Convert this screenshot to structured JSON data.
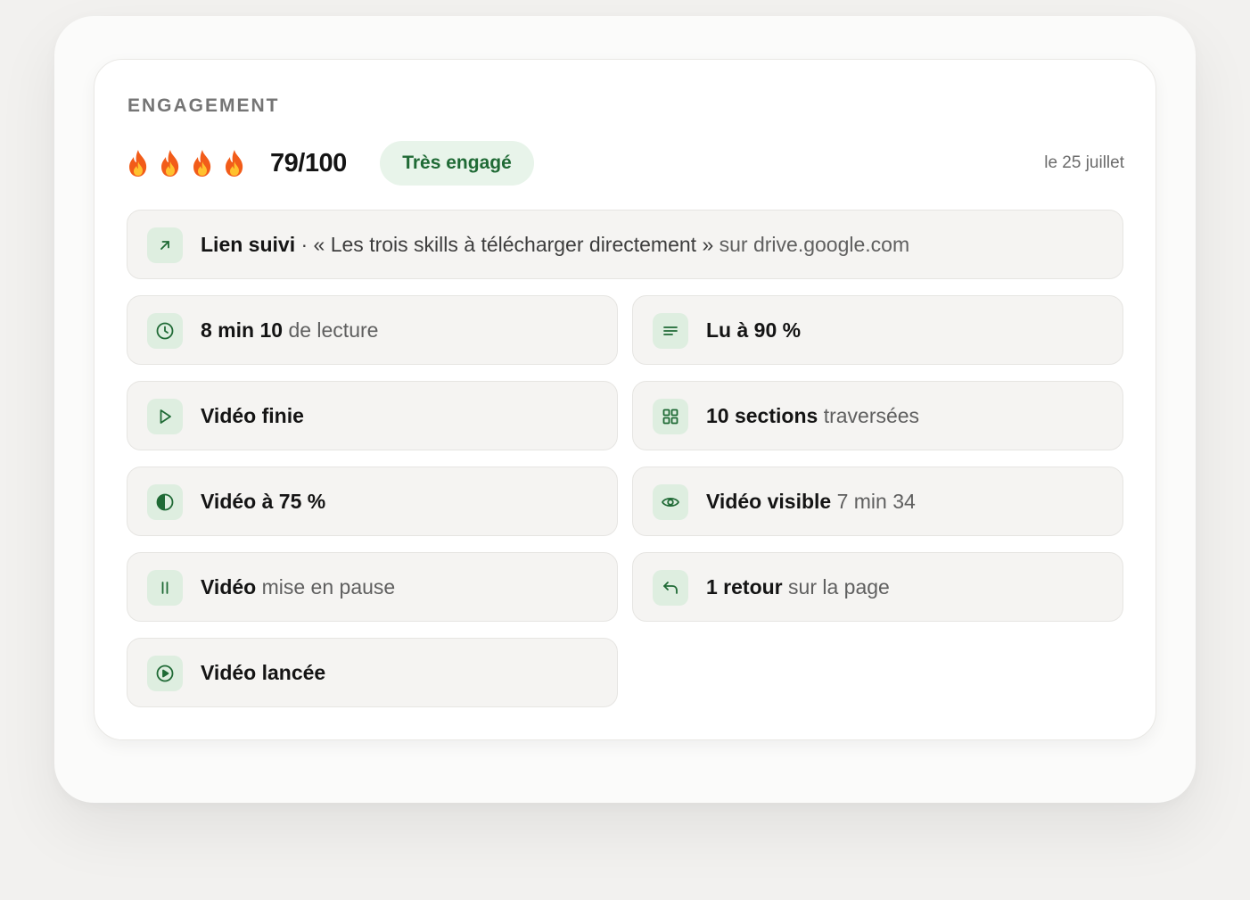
{
  "section_label": "ENGAGEMENT",
  "score": "79/100",
  "badge": "Très engagé",
  "date": "le 25 juillet",
  "colors": {
    "accent_green": "#1f6a35",
    "badge_bg": "#e8f4ea",
    "icon_bg": "#deeee0",
    "row_bg": "#f5f4f2"
  },
  "flames": [
    "fire-icon",
    "fire-icon",
    "fire-icon",
    "fire-icon"
  ],
  "link": {
    "icon": "arrow-up-right-icon",
    "bold": "Lien suivi",
    "separator": "·",
    "title": "« Les trois skills à télécharger directement »",
    "rest": "sur drive.google.com"
  },
  "events": {
    "reading_time": {
      "icon": "clock-icon",
      "bold": "8 min 10",
      "rest": "de lecture"
    },
    "read_percent": {
      "icon": "lines-icon",
      "bold": "Lu à 90 %"
    },
    "video_finished": {
      "icon": "play-icon",
      "bold": "Vidéo finie"
    },
    "sections": {
      "icon": "grid-icon",
      "bold": "10 sections",
      "rest": "traversées"
    },
    "video_75": {
      "icon": "half-circle-icon",
      "bold": "Vidéo à 75 %"
    },
    "video_visible": {
      "icon": "eye-icon",
      "bold": "Vidéo visible",
      "rest": "7 min 34"
    },
    "video_paused": {
      "icon": "pause-icon",
      "bold": "Vidéo",
      "rest": "mise en pause"
    },
    "return_page": {
      "icon": "return-arrow-icon",
      "bold": "1 retour",
      "rest": "sur la page"
    },
    "video_started": {
      "icon": "play-circle-icon",
      "bold": "Vidéo lancée"
    }
  }
}
